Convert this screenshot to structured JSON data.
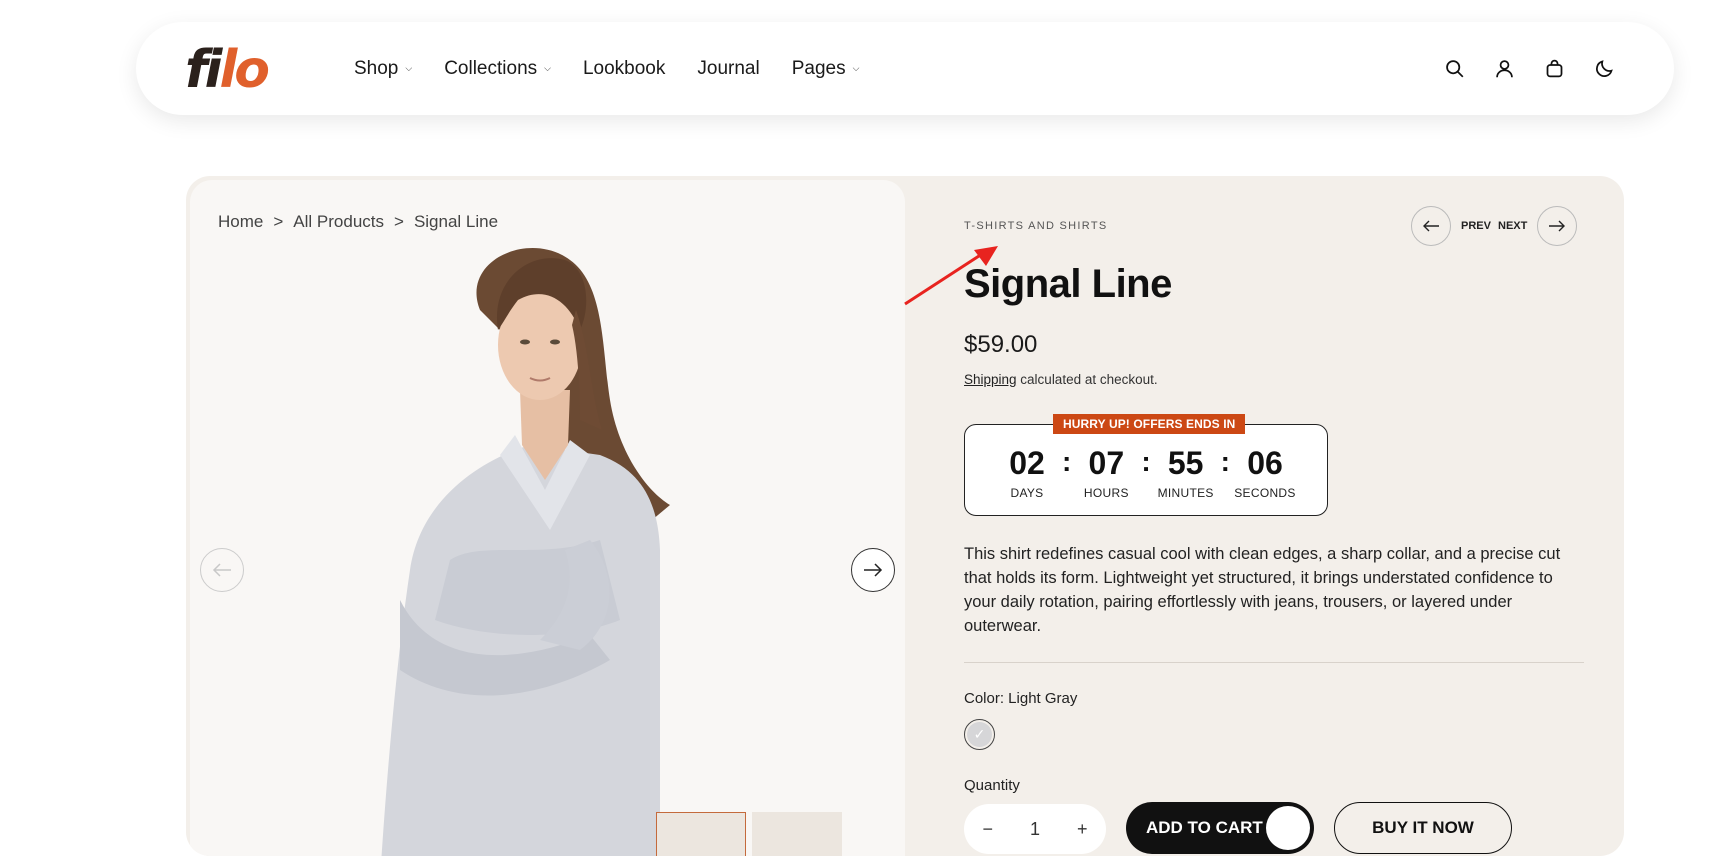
{
  "header": {
    "logo": {
      "part1": "fi",
      "part2": "lo"
    },
    "nav": [
      {
        "label": "Shop",
        "has_dropdown": true
      },
      {
        "label": "Collections",
        "has_dropdown": true
      },
      {
        "label": "Lookbook",
        "has_dropdown": false
      },
      {
        "label": "Journal",
        "has_dropdown": false
      },
      {
        "label": "Pages",
        "has_dropdown": true
      }
    ],
    "icons": [
      "search-icon",
      "account-icon",
      "cart-icon",
      "dark-mode-icon"
    ]
  },
  "breadcrumb": {
    "items": [
      "Home",
      "All Products",
      "Signal Line"
    ],
    "separator": ">"
  },
  "product": {
    "category": "T-SHIRTS AND SHIRTS",
    "prev_label": "PREV",
    "next_label": "NEXT",
    "title": "Signal Line",
    "price": "$59.00",
    "shipping_link": "Shipping",
    "shipping_text": " calculated at checkout.",
    "countdown": {
      "banner": "HURRY UP! OFFERS ENDS IN",
      "days": "02",
      "days_label": "DAYS",
      "hours": "07",
      "hours_label": "HOURS",
      "minutes": "55",
      "minutes_label": "MINUTES",
      "seconds": "06",
      "seconds_label": "SECONDS"
    },
    "description": "This shirt redefines casual cool with clean edges, a sharp collar, and a precise cut that holds its form. Lightweight yet structured, it brings understated confidence to your daily rotation, pairing effortlessly with jeans, trousers, or layered under outerwear.",
    "color_label": "Color: Light Gray",
    "quantity_label": "Quantity",
    "quantity": "1",
    "add_to_cart": "ADD TO CART",
    "buy_now": "BUY IT NOW"
  },
  "colors": {
    "accent": "#e0602c",
    "banner": "#cc4814",
    "panel": "#f3efea",
    "annotation": "#e8231f"
  }
}
